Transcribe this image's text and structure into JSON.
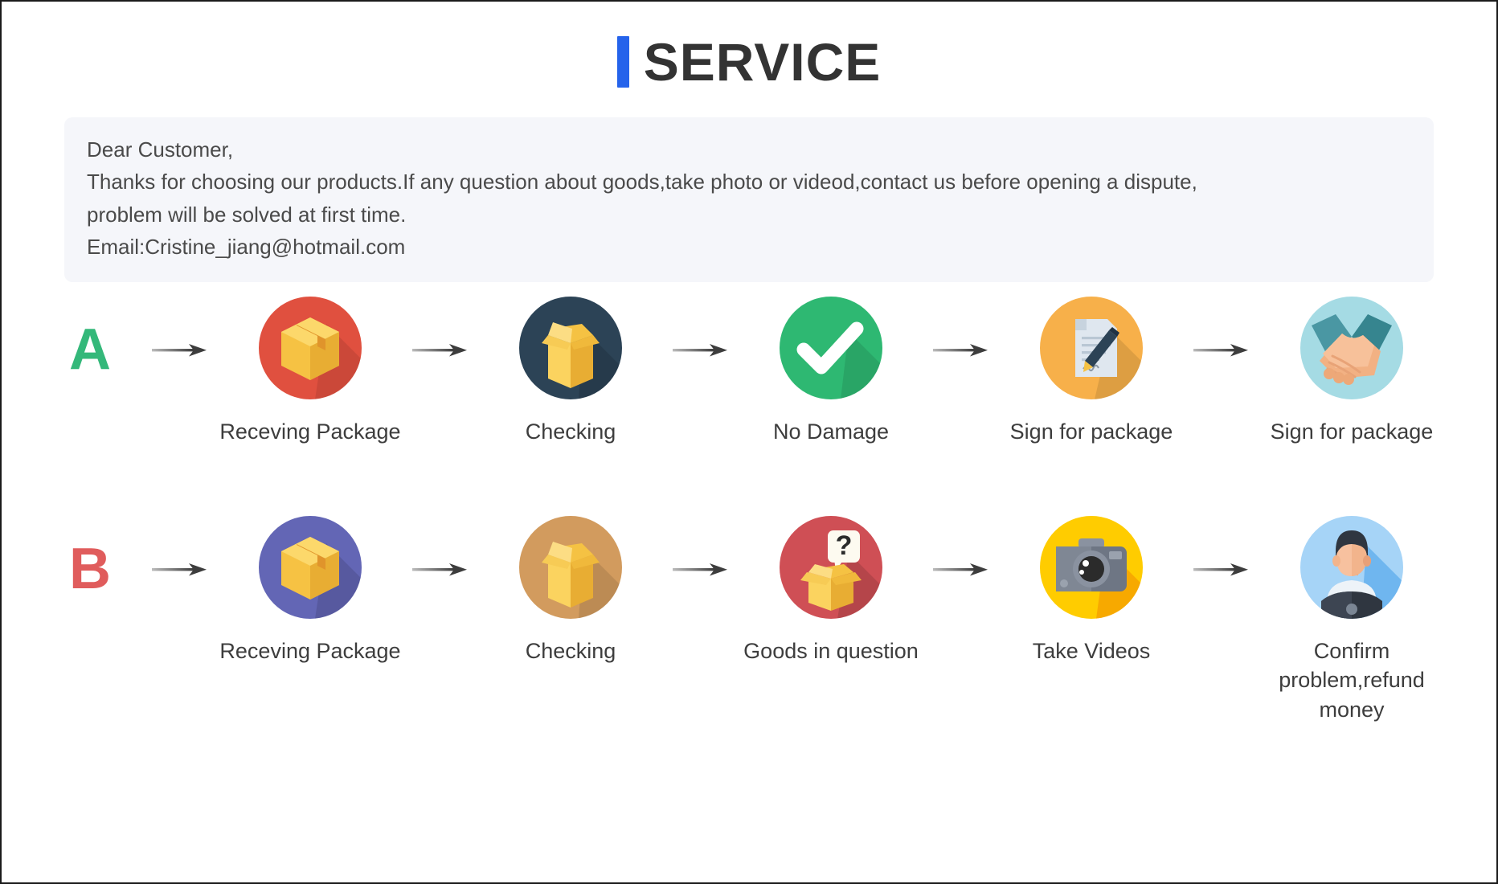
{
  "header": {
    "accent_color": "#2563eb",
    "title": "SERVICE"
  },
  "notice": {
    "line1": "Dear Customer,",
    "line2": "Thanks for choosing our products.If any question about goods,take photo or videod,contact us before opening a dispute,",
    "line3": "problem will be solved at first time.",
    "line4": "Email:Cristine_jiang@hotmail.com",
    "background": "#f5f6fa"
  },
  "flows": [
    {
      "letter": "A",
      "letter_color": "#34b87a",
      "steps": [
        {
          "label": "Receving Package",
          "icon": "sealed-box-icon",
          "circle_color": "#e0503f"
        },
        {
          "label": "Checking",
          "icon": "open-box-icon",
          "circle_color": "#2c4356"
        },
        {
          "label": "No Damage",
          "icon": "check-mark-icon",
          "circle_color": "#2eb872"
        },
        {
          "label": "Sign for package",
          "icon": "sign-document-icon",
          "circle_color": "#f5a93f"
        },
        {
          "label": "Sign for package",
          "icon": "handshake-icon",
          "circle_color": "#a5dbe4"
        }
      ]
    },
    {
      "letter": "B",
      "letter_color": "#e05c5c",
      "steps": [
        {
          "label": "Receving Package",
          "icon": "sealed-box-icon",
          "circle_color": "#6366b5"
        },
        {
          "label": "Checking",
          "icon": "open-box-icon",
          "circle_color": "#d29b5e"
        },
        {
          "label": "Goods in question",
          "icon": "question-box-icon",
          "circle_color": "#cf4f55"
        },
        {
          "label": "Take Videos",
          "icon": "camera-icon",
          "circle_color": "#ffcc00"
        },
        {
          "label": "Confirm problem,refund money",
          "icon": "support-person-icon",
          "circle_color": "#a6d4f7"
        }
      ]
    }
  ],
  "arrow": {
    "name": "arrow-right-icon",
    "color": "#4a4a4a"
  }
}
